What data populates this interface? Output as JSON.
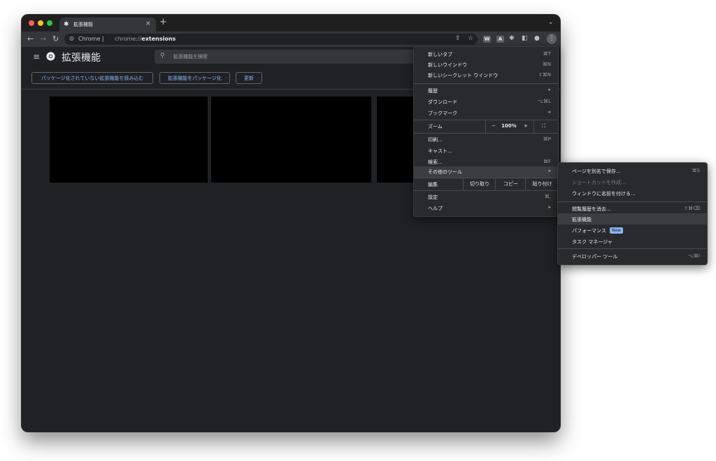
{
  "tab": {
    "title": "拡張機能",
    "close": "×",
    "new_tab": "+"
  },
  "tabsearch": "⌄",
  "omnibox": {
    "chip": "Chrome",
    "url_prefix": "chrome://",
    "url_bold": "extensions"
  },
  "toolbar": {
    "ext_w": "W",
    "ext_a": "A"
  },
  "extensions_page": {
    "title": "拡張機能",
    "search_placeholder": "拡張機能を検索",
    "buttons": {
      "load_unpacked": "パッケージ化されていない拡張機能を読み込む",
      "pack": "拡張機能をパッケージ化",
      "update": "更新"
    }
  },
  "menu": {
    "new_tab": "新しいタブ",
    "new_tab_sc": "⌘T",
    "new_window": "新しいウインドウ",
    "new_window_sc": "⌘N",
    "incognito": "新しいシークレット ウインドウ",
    "incognito_sc": "⇧⌘N",
    "history": "履歴",
    "downloads": "ダウンロード",
    "downloads_sc": "⌥⌘L",
    "bookmarks": "ブックマーク",
    "zoom": "ズーム",
    "zoom_minus": "−",
    "zoom_value": "100%",
    "zoom_plus": "+",
    "print": "印刷...",
    "print_sc": "⌘P",
    "cast": "キャスト...",
    "find": "検索...",
    "find_sc": "⌘F",
    "more_tools": "その他のツール",
    "edit": "編集",
    "cut": "切り取り",
    "copy": "コピー",
    "paste": "貼り付け",
    "settings": "設定",
    "settings_sc": "⌘,",
    "help": "ヘルプ"
  },
  "submenu": {
    "save_as": "ページを別名で保存...",
    "save_as_sc": "⌘S",
    "create_shortcut": "ショートカットを作成...",
    "name_window": "ウィンドウに名前を付ける...",
    "clear_history": "閲覧履歴を消去...",
    "clear_history_sc": "⇧⌘⌫",
    "extensions": "拡張機能",
    "performance": "パフォーマンス",
    "performance_badge": "New",
    "task_manager": "タスク マネージャ",
    "dev_tools": "デベロッパー ツール",
    "dev_tools_sc": "⌥⌘I"
  },
  "colors": {
    "traffic_red": "#ff5f57",
    "traffic_yellow": "#febc2e",
    "traffic_green": "#28c840",
    "accent": "#8ab4f8",
    "surface": "#202124",
    "menu": "#292a2d"
  }
}
